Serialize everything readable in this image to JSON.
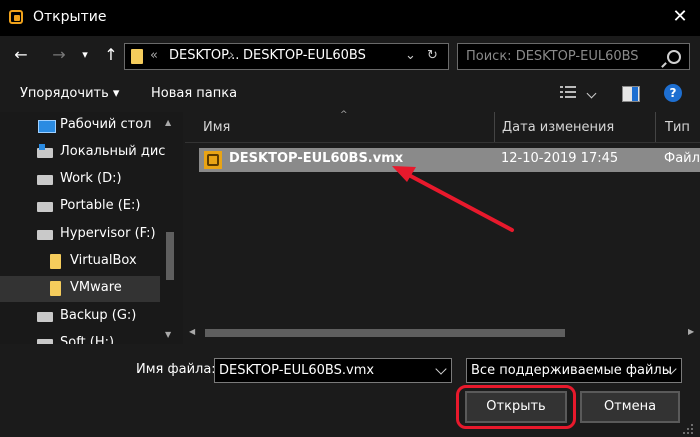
{
  "window": {
    "title": "Открытие",
    "close_glyph": "✕",
    "icon": "vmware-app-icon"
  },
  "nav": {
    "back_glyph": "←",
    "forward_glyph": "→",
    "recent_glyph": "▾",
    "up_glyph": "↑",
    "address_overflow": "«",
    "address_segments": [
      "DESKTOP...",
      "DESKTOP-EUL60BS"
    ],
    "address_separator": "›",
    "address_dropdown_glyph": "⌄",
    "refresh_glyph": "↻"
  },
  "search": {
    "placeholder": "Поиск: DESKTOP-EUL60BS"
  },
  "toolbar": {
    "organize": "Упорядочить ▾",
    "new_folder": "Новая папка",
    "help_glyph": "?"
  },
  "sidebar": {
    "items": [
      {
        "label": "Рабочий стол",
        "icon": "desktop-icon"
      },
      {
        "label": "Локальный дис",
        "icon": "drive-windows-icon"
      },
      {
        "label": "Work (D:)",
        "icon": "drive-icon"
      },
      {
        "label": "Portable (E:)",
        "icon": "drive-icon"
      },
      {
        "label": "Hypervisor (F:)",
        "icon": "drive-icon"
      },
      {
        "label": "VirtualBox",
        "icon": "folder-icon"
      },
      {
        "label": "VMware",
        "icon": "folder-icon",
        "selected": true
      },
      {
        "label": "Backup (G:)",
        "icon": "drive-icon"
      },
      {
        "label": "Soft (H:)",
        "icon": "drive-icon"
      }
    ]
  },
  "columns": {
    "name": "Имя",
    "date": "Дата изменения",
    "type": "Тип"
  },
  "files": [
    {
      "name": "DESKTOP-EUL60BS.vmx",
      "date": "12-10-2019 17:45",
      "type": "Файл"
    }
  ],
  "bottom": {
    "filename_label": "Имя файла:",
    "filename_value": "DESKTOP-EUL60BS.vmx",
    "filetype_value": "Все поддерживаемые файлы",
    "open_button": "Открыть",
    "cancel_button": "Отмена"
  },
  "annotation": {
    "highlight_color": "#e8192c"
  }
}
